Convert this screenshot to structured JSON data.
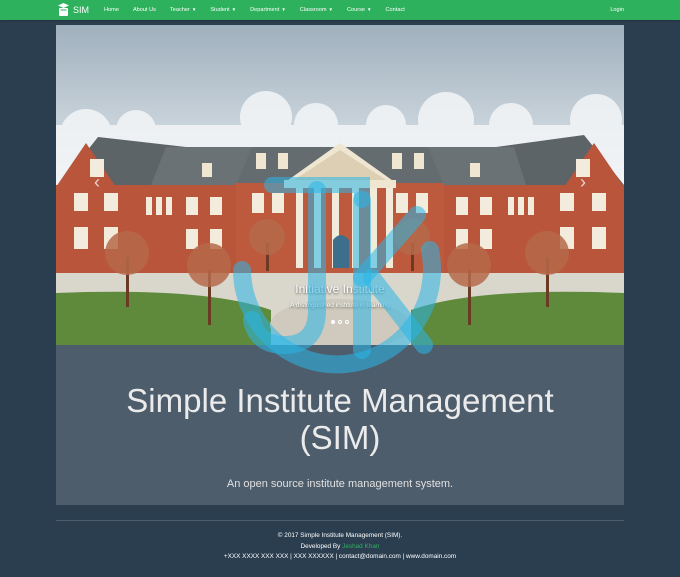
{
  "nav": {
    "brand": "SIM",
    "items": [
      {
        "label": "Home",
        "dropdown": false
      },
      {
        "label": "About Us",
        "dropdown": false
      },
      {
        "label": "Teacher",
        "dropdown": true
      },
      {
        "label": "Student",
        "dropdown": true
      },
      {
        "label": "Department",
        "dropdown": true
      },
      {
        "label": "Classroom",
        "dropdown": true
      },
      {
        "label": "Course",
        "dropdown": true
      },
      {
        "label": "Contact",
        "dropdown": false
      }
    ],
    "login": "Login"
  },
  "carousel": {
    "caption_title": "Initiative Institute",
    "caption_subtitle": "A distinguished institute in learning",
    "slide_count": 3,
    "active_slide": 1
  },
  "jumbotron": {
    "title": "Simple Institute Management (SIM)",
    "lead": "An open source institute management system."
  },
  "footer": {
    "copyright": "© 2017 Simple Institute Management (SIM).",
    "developed_prefix": "Developed By",
    "developer": "Jeshad Khan",
    "contact_line": "+XXX XXXX XXX XXX | XXX XXXXXX | contact@domain.com | www.domain.com"
  },
  "colors": {
    "navbar": "#2eb15c",
    "page_bg": "#2b3e50",
    "jumbotron_bg": "#4e5d6c",
    "watermark": "#29b6e8"
  },
  "icons": {
    "brand": "graduation-book-icon",
    "prev": "chevron-left-icon",
    "next": "chevron-right-icon"
  }
}
